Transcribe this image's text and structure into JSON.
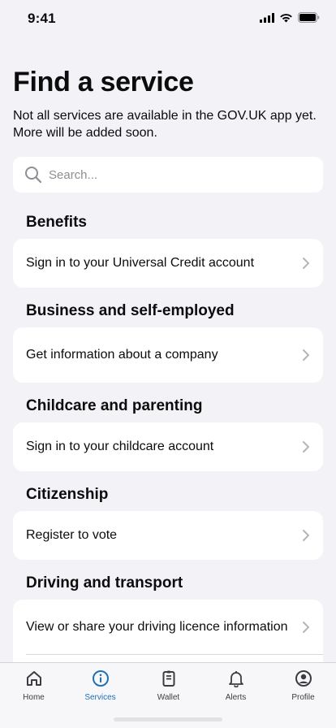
{
  "status_bar": {
    "time": "9:41"
  },
  "header": {
    "title": "Find a service",
    "subtitle": "Not all services are available in the GOV.UK app yet. More will be added soon."
  },
  "search": {
    "placeholder": "Search..."
  },
  "sections": [
    {
      "heading": "Benefits",
      "items": [
        {
          "label": "Sign in to your Universal Credit account"
        }
      ]
    },
    {
      "heading": "Business and self-employed",
      "items": [
        {
          "label": "Get information about a company"
        }
      ]
    },
    {
      "heading": "Childcare and parenting",
      "items": [
        {
          "label": "Sign in to your childcare account"
        }
      ]
    },
    {
      "heading": "Citizenship",
      "items": [
        {
          "label": "Register to vote"
        }
      ]
    },
    {
      "heading": "Driving and transport",
      "items": [
        {
          "label": "View or share your driving licence information"
        }
      ]
    }
  ],
  "tab_bar": {
    "active": "Services",
    "accent_color": "#1d70b8",
    "tabs": [
      {
        "label": "Home",
        "icon": "home-icon"
      },
      {
        "label": "Services",
        "icon": "info-icon"
      },
      {
        "label": "Wallet",
        "icon": "wallet-icon"
      },
      {
        "label": "Alerts",
        "icon": "bell-icon"
      },
      {
        "label": "Profile",
        "icon": "profile-icon"
      }
    ]
  }
}
